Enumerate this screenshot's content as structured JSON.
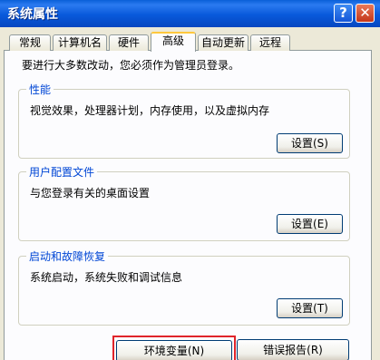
{
  "window": {
    "title": "系统属性",
    "help_glyph": "?",
    "close_glyph": "✕"
  },
  "tabs": [
    {
      "label": "常规",
      "active": false
    },
    {
      "label": "计算机名",
      "active": false
    },
    {
      "label": "硬件",
      "active": false
    },
    {
      "label": "高级",
      "active": true
    },
    {
      "label": "自动更新",
      "active": false
    },
    {
      "label": "远程",
      "active": false
    }
  ],
  "intro": "要进行大多数改动，您必须作为管理员登录。",
  "groups": {
    "performance": {
      "title": "性能",
      "description": "视觉效果，处理器计划，内存使用，以及虚拟内存",
      "button": "设置(S)"
    },
    "user_profiles": {
      "title": "用户配置文件",
      "description": "与您登录有关的桌面设置",
      "button": "设置(E)"
    },
    "startup_recovery": {
      "title": "启动和故障恢复",
      "description": "系统启动，系统失败和调试信息",
      "button": "设置(T)"
    }
  },
  "bottom": {
    "env_button": "环境变量(N)",
    "error_button": "错误报告(R)"
  },
  "colors": {
    "title_bar": "#0859db",
    "group_title": "#0046d5",
    "highlight_box": "#e0242a",
    "active_tab_accent": "#ffc83d"
  }
}
